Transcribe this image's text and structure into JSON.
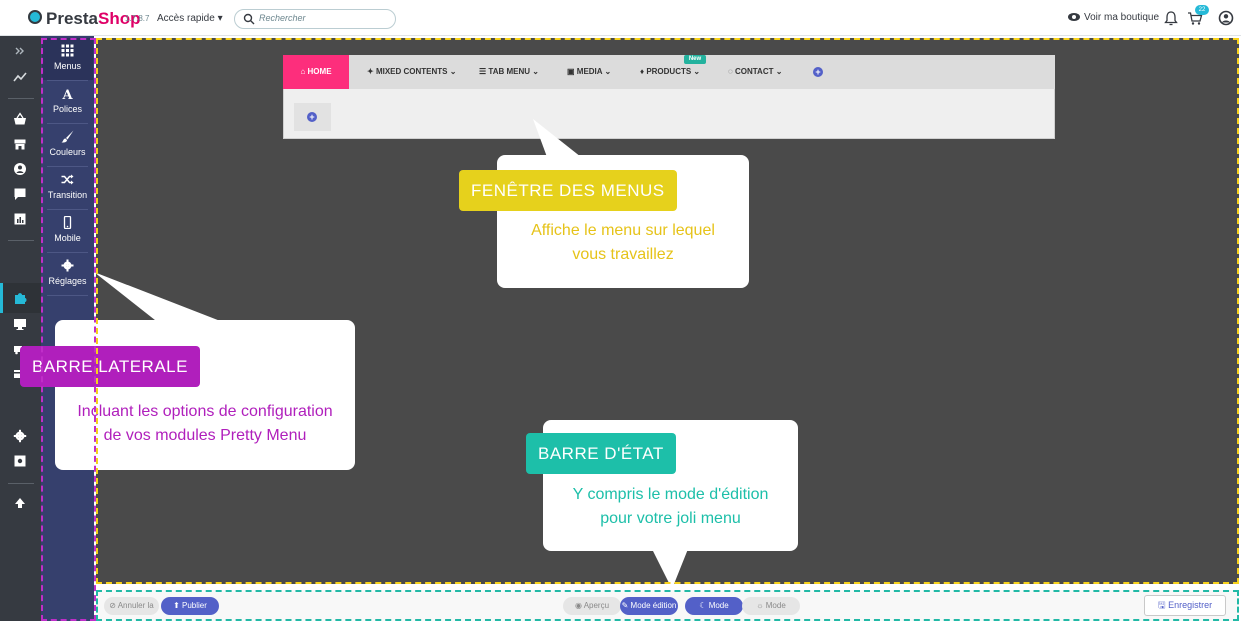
{
  "topbar": {
    "brand_a": "Presta",
    "brand_b": "Shop",
    "version": "1.7.8.7",
    "quick_access": "Accès rapide ▾",
    "search_placeholder": "Rechercher",
    "view_shop": "Voir ma boutique",
    "cart_count": "22"
  },
  "sidebar": {
    "items": [
      {
        "label": "Menus",
        "icon": "grid-icon"
      },
      {
        "label": "Polices",
        "icon": "font-icon"
      },
      {
        "label": "Couleurs",
        "icon": "brush-icon"
      },
      {
        "label": "Transition",
        "icon": "shuffle-icon"
      },
      {
        "label": "Mobile",
        "icon": "mobile-icon"
      },
      {
        "label": "Réglages",
        "icon": "gear-icon"
      }
    ]
  },
  "menu_preview": {
    "home": "HOME",
    "items": [
      "MIXED CONTENTS",
      "TAB MENU",
      "MEDIA",
      "PRODUCTS",
      "CONTACT"
    ],
    "new_badge": "New",
    "add_symbol": "+"
  },
  "callouts": {
    "menus_window": {
      "tag": "FENÊTRE DES MENUS",
      "line1": "Affiche le menu sur lequel",
      "line2": "vous travaillez",
      "color": "#e6d11c"
    },
    "sidebar": {
      "tag": "BARRE LATERALE",
      "line1": "Incluant les options de configuration",
      "line2": "de vos modules Pretty Menu",
      "color": "#b01fbc"
    },
    "statusbar": {
      "tag": "BARRE D'ÉTAT",
      "line1": "Y compris le mode d'édition",
      "line2": "pour votre joli menu",
      "color": "#1dbfa9"
    }
  },
  "statusbar": {
    "cancel": "⊘ Annuler la",
    "publish": "⬆ Publier",
    "preview": "◉ Aperçu",
    "edit_mode": "✎ Mode édition",
    "dark_mode": "☾ Mode",
    "light_mode": "☼ Mode",
    "save": "🖫 Enregistrer"
  }
}
